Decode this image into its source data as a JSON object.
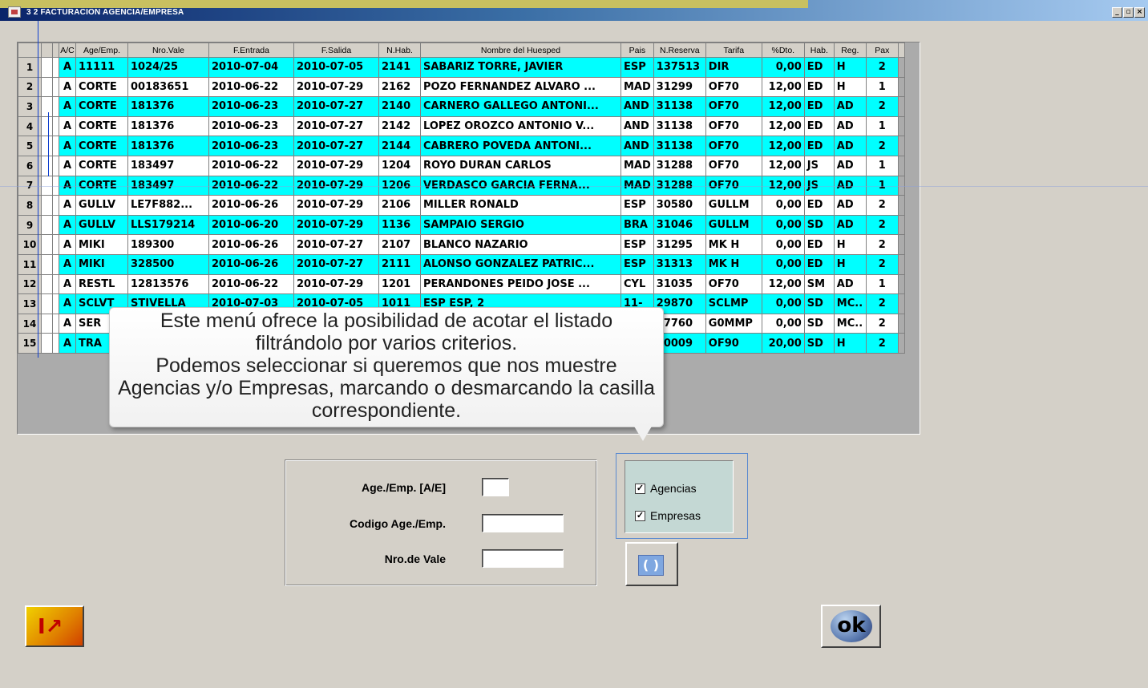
{
  "window": {
    "title": "3 2  FACTURACION AGENCIA/EMPRESA",
    "min_label": "_",
    "restore_label": "▫",
    "close_label": "×"
  },
  "grid": {
    "headers": [
      "A/C",
      "Age/Emp.",
      "Nro.Vale",
      "F.Entrada",
      "F.Salida",
      "N.Hab.",
      "Nombre del Huesped",
      "Pais",
      "N.Reserva",
      "Tarifa",
      "%Dto.",
      "Hab.",
      "Reg.",
      "Pax"
    ],
    "rows": [
      {
        "n": "1",
        "ac": "A",
        "age": "11111",
        "vale": "1024/25",
        "fent": "2010-07-04",
        "fsal": "2010-07-05",
        "hab": "2141",
        "nombre": "SABARIZ TORRE, JAVIER",
        "pais": "ESP",
        "res": "137513",
        "tarifa": "DIR",
        "dto": "0,00",
        "htype": "ED",
        "reg": "H",
        "pax": "2"
      },
      {
        "n": "2",
        "ac": "A",
        "age": "CORTE",
        "vale": "00183651",
        "fent": "2010-06-22",
        "fsal": "2010-07-29",
        "hab": "2162",
        "nombre": "POZO FERNANDEZ ALVARO ...",
        "pais": "MAD",
        "res": "31299",
        "tarifa": "OF70",
        "dto": "12,00",
        "htype": "ED",
        "reg": "H",
        "pax": "1"
      },
      {
        "n": "3",
        "ac": "A",
        "age": "CORTE",
        "vale": "181376",
        "fent": "2010-06-23",
        "fsal": "2010-07-27",
        "hab": "2140",
        "nombre": "CARNERO GALLEGO ANTONI...",
        "pais": "AND",
        "res": "31138",
        "tarifa": "OF70",
        "dto": "12,00",
        "htype": "ED",
        "reg": "AD",
        "pax": "2"
      },
      {
        "n": "4",
        "ac": "A",
        "age": "CORTE",
        "vale": "181376",
        "fent": "2010-06-23",
        "fsal": "2010-07-27",
        "hab": "2142",
        "nombre": "LOPEZ OROZCO ANTONIO V...",
        "pais": "AND",
        "res": "31138",
        "tarifa": "OF70",
        "dto": "12,00",
        "htype": "ED",
        "reg": "AD",
        "pax": "1"
      },
      {
        "n": "5",
        "ac": "A",
        "age": "CORTE",
        "vale": "181376",
        "fent": "2010-06-23",
        "fsal": "2010-07-27",
        "hab": "2144",
        "nombre": "CABRERO POVEDA ANTONI...",
        "pais": "AND",
        "res": "31138",
        "tarifa": "OF70",
        "dto": "12,00",
        "htype": "ED",
        "reg": "AD",
        "pax": "2"
      },
      {
        "n": "6",
        "ac": "A",
        "age": "CORTE",
        "vale": "183497",
        "fent": "2010-06-22",
        "fsal": "2010-07-29",
        "hab": "1204",
        "nombre": "ROYO DURAN CARLOS",
        "pais": "MAD",
        "res": "31288",
        "tarifa": "OF70",
        "dto": "12,00",
        "htype": "JS",
        "reg": "AD",
        "pax": "1"
      },
      {
        "n": "7",
        "ac": "A",
        "age": "CORTE",
        "vale": "183497",
        "fent": "2010-06-22",
        "fsal": "2010-07-29",
        "hab": "1206",
        "nombre": "VERDASCO GARCIA FERNA...",
        "pais": "MAD",
        "res": "31288",
        "tarifa": "OF70",
        "dto": "12,00",
        "htype": "JS",
        "reg": "AD",
        "pax": "1"
      },
      {
        "n": "8",
        "ac": "A",
        "age": "GULLV",
        "vale": "LE7F882...",
        "fent": "2010-06-26",
        "fsal": "2010-07-29",
        "hab": "2106",
        "nombre": "MILLER RONALD",
        "pais": "ESP",
        "res": "30580",
        "tarifa": "GULLM",
        "dto": "0,00",
        "htype": "ED",
        "reg": "AD",
        "pax": "2"
      },
      {
        "n": "9",
        "ac": "A",
        "age": "GULLV",
        "vale": "LLS179214",
        "fent": "2010-06-20",
        "fsal": "2010-07-29",
        "hab": "1136",
        "nombre": "SAMPAIO SERGIO",
        "pais": "BRA",
        "res": "31046",
        "tarifa": "GULLM",
        "dto": "0,00",
        "htype": "SD",
        "reg": "AD",
        "pax": "2"
      },
      {
        "n": "10",
        "ac": "A",
        "age": "MIKI",
        "vale": "189300",
        "fent": "2010-06-26",
        "fsal": "2010-07-27",
        "hab": "2107",
        "nombre": "BLANCO NAZARIO",
        "pais": "ESP",
        "res": "31295",
        "tarifa": "MK H",
        "dto": "0,00",
        "htype": "ED",
        "reg": "H",
        "pax": "2"
      },
      {
        "n": "11",
        "ac": "A",
        "age": "MIKI",
        "vale": "328500",
        "fent": "2010-06-26",
        "fsal": "2010-07-27",
        "hab": "2111",
        "nombre": "ALONSO GONZALEZ PATRIC...",
        "pais": "ESP",
        "res": "31313",
        "tarifa": "MK H",
        "dto": "0,00",
        "htype": "ED",
        "reg": "H",
        "pax": "2"
      },
      {
        "n": "12",
        "ac": "A",
        "age": "RESTL",
        "vale": "12813576",
        "fent": "2010-06-22",
        "fsal": "2010-07-29",
        "hab": "1201",
        "nombre": "PERANDONES PEIDO JOSE ...",
        "pais": "CYL",
        "res": "31035",
        "tarifa": "OF70",
        "dto": "12,00",
        "htype": "SM",
        "reg": "AD",
        "pax": "1"
      },
      {
        "n": "13",
        "ac": "A",
        "age": "SCLVT",
        "vale": "STIVELLA",
        "fent": "2010-07-03",
        "fsal": "2010-07-05",
        "hab": "1011",
        "nombre": "ESP ESP, 2",
        "pais": "11-",
        "res": "29870",
        "tarifa": "SCLMP",
        "dto": "0,00",
        "htype": "SD",
        "reg": "MC..",
        "pax": "2"
      },
      {
        "n": "14",
        "ac": "A",
        "age": "SER",
        "vale": "",
        "fent": "",
        "fsal": "",
        "hab": "",
        "nombre": "",
        "pais": "",
        "res": "27760",
        "tarifa": "G0MMP",
        "dto": "0,00",
        "htype": "SD",
        "reg": "MC..",
        "pax": "2"
      },
      {
        "n": "15",
        "ac": "A",
        "age": "TRA",
        "vale": "",
        "fent": "",
        "fsal": "",
        "hab": "",
        "nombre": "",
        "pais": "",
        "res": "30009",
        "tarifa": "OF90",
        "dto": "20,00",
        "htype": "SD",
        "reg": "H",
        "pax": "2"
      }
    ]
  },
  "callout": {
    "line1": "Este menú ofrece la posibilidad de acotar el listado",
    "line2": "filtrándolo por varios criterios.",
    "line3": "Podemos seleccionar si queremos que nos muestre",
    "line4": "Agencias y/o Empresas, marcando o desmarcando la casilla",
    "line5": "correspondiente."
  },
  "filters": {
    "age_emp_label": "Age./Emp.  [A/E]",
    "age_emp_value": "",
    "codigo_label": "Codigo Age./Emp.",
    "codigo_value": "",
    "vale_label": "Nro.de Vale",
    "vale_value": ""
  },
  "checks": {
    "agencias_label": "Agencias",
    "agencias_checked": true,
    "empresas_label": "Empresas",
    "empresas_checked": true,
    "check_glyph": "✓"
  },
  "buttons": {
    "refresh_glyph": "( )",
    "exit_glyph": "I↗",
    "ok_label": "ok"
  },
  "colors": {
    "odd_row": "#00ffff",
    "even_row": "#ffffff",
    "window_bg": "#d4d0c8"
  }
}
